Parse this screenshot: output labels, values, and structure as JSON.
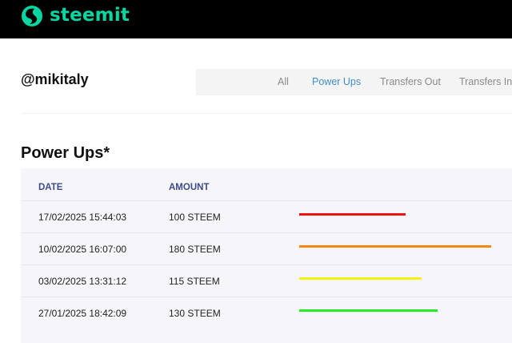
{
  "header": {
    "brand": "steemit",
    "brand_color": "#07d6a2",
    "logo_icon": "steemit-logo-icon"
  },
  "profile": {
    "username": "@mikitaly"
  },
  "tabs": [
    {
      "label": "All",
      "active": false
    },
    {
      "label": "Power Ups",
      "active": true
    },
    {
      "label": "Transfers Out",
      "active": false
    },
    {
      "label": "Transfers In",
      "active": false
    }
  ],
  "section": {
    "title": "Power Ups*"
  },
  "table": {
    "headers": [
      "DATE",
      "AMOUNT"
    ],
    "rows": [
      {
        "date": "17/02/2025 15:44:03",
        "amount": "100 STEEM",
        "bar_color": "#ee1111"
      },
      {
        "date": "10/02/2025 16:07:00",
        "amount": "180 STEEM",
        "bar_color": "#f58a10"
      },
      {
        "date": "03/02/2025 13:31:12",
        "amount": "115 STEEM",
        "bar_color": "#f2f20a"
      },
      {
        "date": "27/01/2025 18:42:09",
        "amount": "130 STEEM",
        "bar_color": "#22ee22"
      }
    ],
    "bar_values": [
      100,
      180,
      115,
      130
    ],
    "bar_max": 180
  },
  "colors": {
    "topbar": "#000000",
    "active_tab": "#3e8ecb",
    "table_bg": "#f6f6fa",
    "header_text": "#3c4b8a"
  }
}
